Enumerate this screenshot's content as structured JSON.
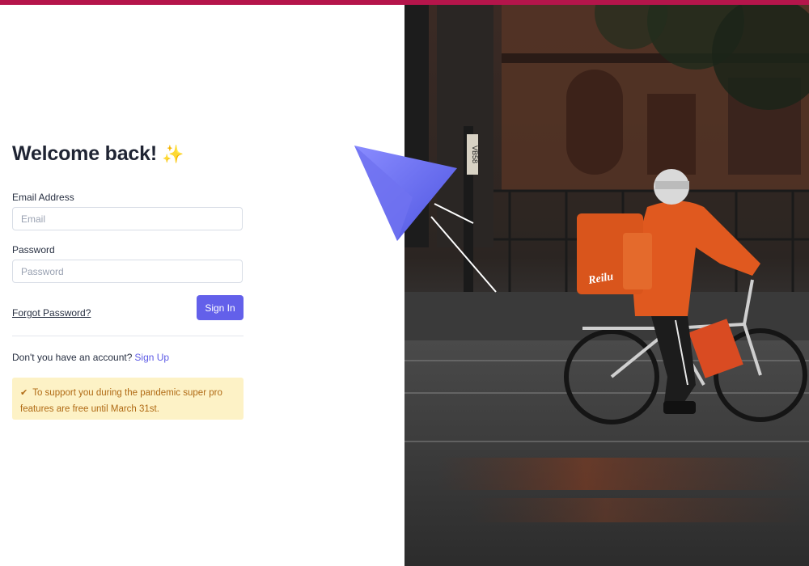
{
  "login": {
    "title": "Welcome back!",
    "title_emoji": "✨",
    "email_label": "Email Address",
    "email_placeholder": "Email",
    "email_value": "",
    "password_label": "Password",
    "password_placeholder": "Password",
    "password_value": "",
    "forgot_label": "Forgot Password?",
    "signin_label": "Sign In",
    "signup_prompt": "Don't you have an account?",
    "signup_label": "Sign Up",
    "notice_icon": "check-icon",
    "notice_text": "To support you during the pandemic super pro features are free until March 31st."
  },
  "hero": {
    "bag_brand": "Reilu",
    "sign_text": "VB58"
  },
  "colors": {
    "top_bar": "#b5154b",
    "primary": "#6360ea",
    "link": "#5e5ce6",
    "notice_bg": "#fdf2c6",
    "notice_text": "#b06a14",
    "title": "#1f2433",
    "jacket": "#e0591f"
  }
}
